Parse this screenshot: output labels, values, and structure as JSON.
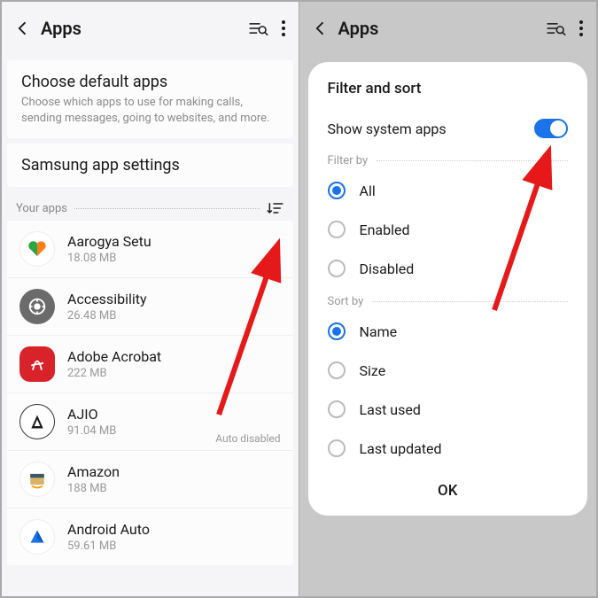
{
  "left": {
    "header": {
      "title": "Apps"
    },
    "default_apps": {
      "title": "Choose default apps",
      "subtitle": "Choose which apps to use for making calls, sending messages, going to websites, and more."
    },
    "samsung": {
      "title": "Samsung app settings"
    },
    "section_label": "Your apps",
    "apps": [
      {
        "name": "Aarogya Setu",
        "size": "18.08 MB",
        "status": ""
      },
      {
        "name": "Accessibility",
        "size": "26.48 MB",
        "status": ""
      },
      {
        "name": "Adobe Acrobat",
        "size": "222 MB",
        "status": ""
      },
      {
        "name": "AJIO",
        "size": "91.04 MB",
        "status": "Auto disabled"
      },
      {
        "name": "Amazon",
        "size": "188 MB",
        "status": ""
      },
      {
        "name": "Android Auto",
        "size": "59.61 MB",
        "status": ""
      }
    ]
  },
  "right": {
    "header": {
      "title": "Apps"
    },
    "dialog": {
      "title": "Filter and sort",
      "show_system": "Show system apps",
      "filter_label": "Filter by",
      "filter_options": [
        "All",
        "Enabled",
        "Disabled"
      ],
      "sort_label": "Sort by",
      "sort_options": [
        "Name",
        "Size",
        "Last used",
        "Last updated"
      ],
      "ok": "OK"
    }
  }
}
